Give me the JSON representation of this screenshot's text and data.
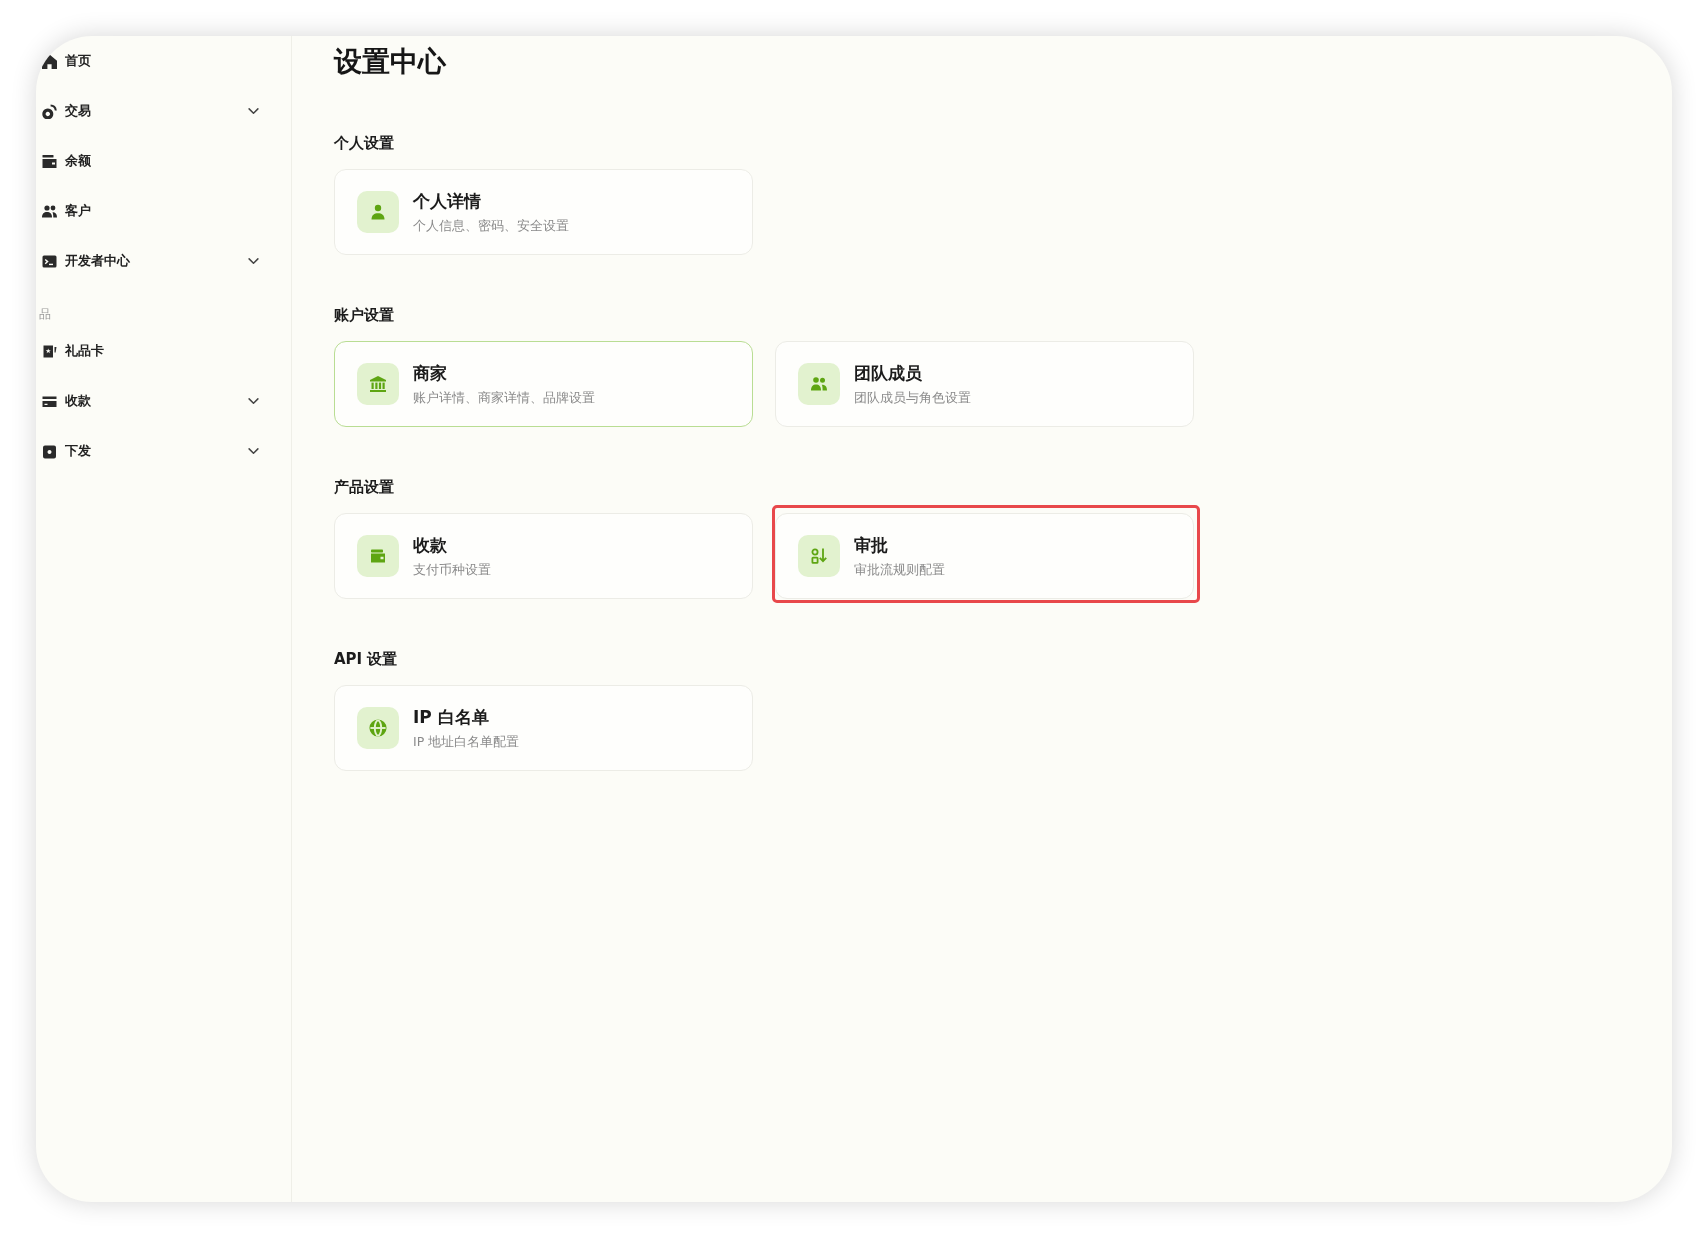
{
  "sidebar": {
    "groups": [
      {
        "items": [
          {
            "label": "首页",
            "kind": "link",
            "selected": false
          },
          {
            "label": "交易",
            "kind": "group",
            "selected": false,
            "expanded": false
          },
          {
            "label": "余额",
            "kind": "link",
            "selected": false
          },
          {
            "label": "客户",
            "kind": "link",
            "selected": false
          },
          {
            "label": "开发者中心",
            "kind": "group",
            "selected": false,
            "expanded": false
          }
        ]
      },
      {
        "title": "品",
        "items": [
          {
            "label": "礼品卡",
            "kind": "link",
            "selected": false
          },
          {
            "label": "收款",
            "kind": "group",
            "selected": false,
            "expanded": false
          },
          {
            "label": "下发",
            "kind": "group",
            "selected": false,
            "expanded": false
          }
        ]
      }
    ]
  },
  "page": {
    "title": "设置中心",
    "sections": [
      {
        "title": "个人设置",
        "cards": [
          {
            "title": "个人详情",
            "description": "个人信息、密码、安全设置",
            "selected": false,
            "highlighted": false
          }
        ]
      },
      {
        "title": "账户设置",
        "cards": [
          {
            "title": "商家",
            "description": "账户详情、商家详情、品牌设置",
            "selected": true,
            "highlighted": false
          },
          {
            "title": "团队成员",
            "description": "团队成员与角色设置",
            "selected": false,
            "highlighted": false
          }
        ]
      },
      {
        "title": "产品设置",
        "cards": [
          {
            "title": "收款",
            "description": "支付币种设置",
            "selected": false,
            "highlighted": false
          },
          {
            "title": "审批",
            "description": "审批流规则配置",
            "selected": false,
            "highlighted": true
          }
        ]
      },
      {
        "title": "API 设置",
        "cards": [
          {
            "title": "IP 白名单",
            "description": "IP 地址白名单配置",
            "selected": false,
            "highlighted": false
          }
        ]
      }
    ]
  }
}
